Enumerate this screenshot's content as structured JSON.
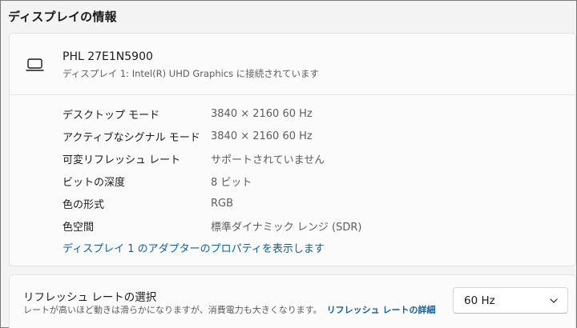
{
  "page": {
    "title": "ディスプレイの情報"
  },
  "display": {
    "name": "PHL 27E1N5900",
    "subtitle": "ディスプレイ 1: Intel(R) UHD Graphics に接続されています",
    "icon": "monitor-icon",
    "rows": [
      {
        "label": "デスクトップ モード",
        "value": "3840 × 2160 60 Hz"
      },
      {
        "label": "アクティブなシグナル モード",
        "value": "3840 × 2160 60 Hz"
      },
      {
        "label": "可変リフレッシュ レート",
        "value": "サポートされていません"
      },
      {
        "label": "ビットの深度",
        "value": "8 ビット"
      },
      {
        "label": "色の形式",
        "value": "RGB"
      },
      {
        "label": "色空間",
        "value": "標準ダイナミック レンジ (SDR)"
      }
    ],
    "adapter_link": "ディスプレイ 1 のアダプターのプロパティを表示します"
  },
  "refresh": {
    "title": "リフレッシュ レートの選択",
    "description": "レートが高いほど動きは滑らかになりますが、消費電力も大きくなります。",
    "link": "リフレッシュ レートの詳細",
    "selected": "60 Hz"
  },
  "colors": {
    "background": "#f3f3f3",
    "card": "#fbfbfb",
    "link": "#0f5fa8",
    "secondary_text": "#5d5d5d"
  }
}
